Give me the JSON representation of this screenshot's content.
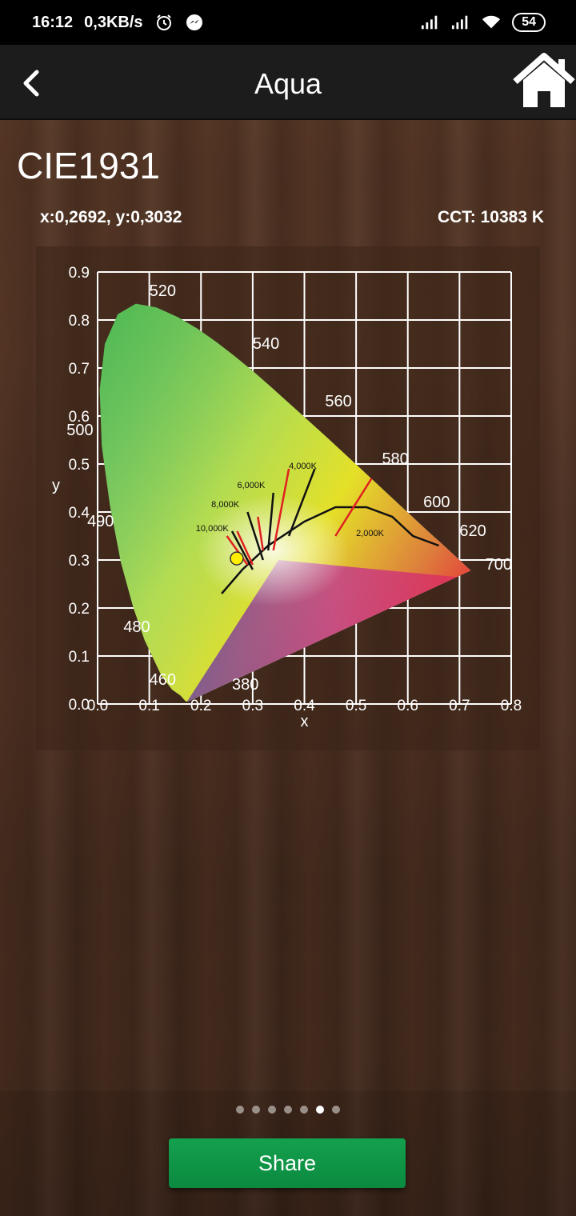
{
  "status_bar": {
    "time": "16:12",
    "net_speed": "0,3KB/s",
    "battery": "54",
    "icons": [
      "alarm-icon",
      "messenger-icon",
      "signal-icon",
      "signal-icon",
      "wifi-icon",
      "battery-icon"
    ]
  },
  "app_bar": {
    "title": "Aqua",
    "back_icon": "chevron-left-icon",
    "home_icon": "home-icon"
  },
  "page": {
    "heading": "CIE1931",
    "coords": "x:0,2692, y:0,3032",
    "cct": "CCT: 10383 K"
  },
  "pager": {
    "count": 7,
    "active": 5
  },
  "share_label": "Share",
  "colors": {
    "accent": "#0f9447",
    "marker": "#ffee00"
  },
  "chart_data": {
    "type": "scatter",
    "title": "",
    "xlabel": "x",
    "ylabel": "y",
    "xlim": [
      0.0,
      0.8
    ],
    "ylim": [
      0.0,
      0.9
    ],
    "xticks": [
      "0.0",
      "0.1",
      "0.2",
      "0.3",
      "0.4",
      "0.5",
      "0.6",
      "0.7",
      "0.8"
    ],
    "yticks": [
      "0.0",
      "0.1",
      "0.2",
      "0.3",
      "0.4",
      "0.5",
      "0.6",
      "0.7",
      "0.8",
      "0.9"
    ],
    "grid": true,
    "wavelength_labels": [
      {
        "text": "380",
        "x": 0.26,
        "y": 0.03
      },
      {
        "text": "460",
        "x": 0.1,
        "y": 0.04
      },
      {
        "text": "480",
        "x": 0.05,
        "y": 0.15
      },
      {
        "text": "490",
        "x": -0.02,
        "y": 0.37
      },
      {
        "text": "500",
        "x": -0.06,
        "y": 0.56
      },
      {
        "text": "520",
        "x": 0.1,
        "y": 0.85
      },
      {
        "text": "540",
        "x": 0.3,
        "y": 0.74
      },
      {
        "text": "560",
        "x": 0.44,
        "y": 0.62
      },
      {
        "text": "580",
        "x": 0.55,
        "y": 0.5
      },
      {
        "text": "600",
        "x": 0.63,
        "y": 0.41
      },
      {
        "text": "620",
        "x": 0.7,
        "y": 0.35
      },
      {
        "text": "700",
        "x": 0.75,
        "y": 0.28
      }
    ],
    "cct_labels": [
      {
        "text": "10,000K",
        "x": 0.19,
        "y": 0.36
      },
      {
        "text": "8,000K",
        "x": 0.22,
        "y": 0.41
      },
      {
        "text": "6,000K",
        "x": 0.27,
        "y": 0.45
      },
      {
        "text": "4,000K",
        "x": 0.37,
        "y": 0.49
      },
      {
        "text": "2,000K",
        "x": 0.5,
        "y": 0.35
      }
    ],
    "points": [
      {
        "x": 0.2692,
        "y": 0.3032
      }
    ]
  }
}
